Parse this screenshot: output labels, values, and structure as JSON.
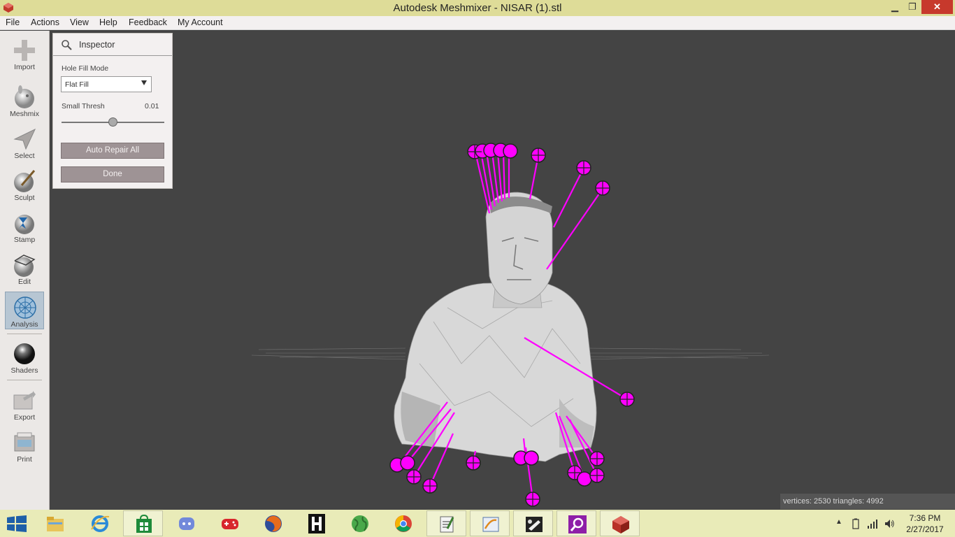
{
  "window": {
    "title": "Autodesk Meshmixer - NISAR (1).stl",
    "controls": {
      "minimize": "▁",
      "maximize": "❐",
      "close": "✕"
    }
  },
  "menu": {
    "items": [
      "File",
      "Actions",
      "View",
      "Help",
      "Feedback",
      "My Account"
    ]
  },
  "toolbar": {
    "items": [
      {
        "label": "Import",
        "icon": "plus-icon"
      },
      {
        "label": "Meshmix",
        "icon": "bunny-icon"
      },
      {
        "label": "Select",
        "icon": "arrow-cursor-icon"
      },
      {
        "label": "Sculpt",
        "icon": "brush-sphere-icon"
      },
      {
        "label": "Stamp",
        "icon": "stamp-sphere-icon"
      },
      {
        "label": "Edit",
        "icon": "edit-sphere-icon"
      },
      {
        "label": "Analysis",
        "icon": "analysis-sphere-icon",
        "active": true
      },
      {
        "label": "Shaders",
        "icon": "shader-sphere-icon"
      },
      {
        "label": "Export",
        "icon": "export-icon"
      },
      {
        "label": "Print",
        "icon": "printer-icon"
      }
    ]
  },
  "inspector": {
    "title": "Inspector",
    "hole_fill_mode_label": "Hole Fill Mode",
    "hole_fill_mode_value": "Flat Fill",
    "small_thresh_label": "Small Thresh",
    "small_thresh_value": "0.01",
    "auto_repair_label": "Auto Repair All",
    "done_label": "Done"
  },
  "status": {
    "text": "vertices: 2530 triangles: 4992"
  },
  "colors": {
    "title_bar": "#dedc98",
    "viewport": "#444444",
    "marker": "#ff00ff",
    "taskbar": "#e9ebb8",
    "button": "#9e9395"
  },
  "taskbar": {
    "apps": [
      "file-explorer-icon",
      "internet-explorer-icon",
      "store-icon",
      "discord-icon",
      "game-controller-icon",
      "firefox-icon",
      "h-app-icon",
      "globe-icon",
      "chrome-icon",
      "notepad-icon",
      "presentation-icon",
      "paint-icon",
      "search-app-icon",
      "meshmixer-icon"
    ],
    "time": "7:36 PM",
    "date": "2/27/2017"
  }
}
